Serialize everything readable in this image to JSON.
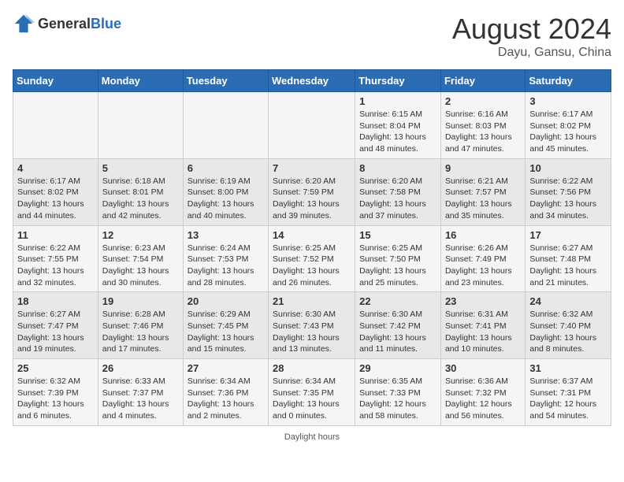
{
  "header": {
    "logo_general": "General",
    "logo_blue": "Blue",
    "month_year": "August 2024",
    "location": "Dayu, Gansu, China"
  },
  "days_of_week": [
    "Sunday",
    "Monday",
    "Tuesday",
    "Wednesday",
    "Thursday",
    "Friday",
    "Saturday"
  ],
  "footer": {
    "daylight_label": "Daylight hours"
  },
  "weeks": [
    {
      "cells": [
        {
          "day": "",
          "content": ""
        },
        {
          "day": "",
          "content": ""
        },
        {
          "day": "",
          "content": ""
        },
        {
          "day": "",
          "content": ""
        },
        {
          "day": "1",
          "content": "Sunrise: 6:15 AM\nSunset: 8:04 PM\nDaylight: 13 hours\nand 48 minutes."
        },
        {
          "day": "2",
          "content": "Sunrise: 6:16 AM\nSunset: 8:03 PM\nDaylight: 13 hours\nand 47 minutes."
        },
        {
          "day": "3",
          "content": "Sunrise: 6:17 AM\nSunset: 8:02 PM\nDaylight: 13 hours\nand 45 minutes."
        }
      ]
    },
    {
      "cells": [
        {
          "day": "4",
          "content": "Sunrise: 6:17 AM\nSunset: 8:02 PM\nDaylight: 13 hours\nand 44 minutes."
        },
        {
          "day": "5",
          "content": "Sunrise: 6:18 AM\nSunset: 8:01 PM\nDaylight: 13 hours\nand 42 minutes."
        },
        {
          "day": "6",
          "content": "Sunrise: 6:19 AM\nSunset: 8:00 PM\nDaylight: 13 hours\nand 40 minutes."
        },
        {
          "day": "7",
          "content": "Sunrise: 6:20 AM\nSunset: 7:59 PM\nDaylight: 13 hours\nand 39 minutes."
        },
        {
          "day": "8",
          "content": "Sunrise: 6:20 AM\nSunset: 7:58 PM\nDaylight: 13 hours\nand 37 minutes."
        },
        {
          "day": "9",
          "content": "Sunrise: 6:21 AM\nSunset: 7:57 PM\nDaylight: 13 hours\nand 35 minutes."
        },
        {
          "day": "10",
          "content": "Sunrise: 6:22 AM\nSunset: 7:56 PM\nDaylight: 13 hours\nand 34 minutes."
        }
      ]
    },
    {
      "cells": [
        {
          "day": "11",
          "content": "Sunrise: 6:22 AM\nSunset: 7:55 PM\nDaylight: 13 hours\nand 32 minutes."
        },
        {
          "day": "12",
          "content": "Sunrise: 6:23 AM\nSunset: 7:54 PM\nDaylight: 13 hours\nand 30 minutes."
        },
        {
          "day": "13",
          "content": "Sunrise: 6:24 AM\nSunset: 7:53 PM\nDaylight: 13 hours\nand 28 minutes."
        },
        {
          "day": "14",
          "content": "Sunrise: 6:25 AM\nSunset: 7:52 PM\nDaylight: 13 hours\nand 26 minutes."
        },
        {
          "day": "15",
          "content": "Sunrise: 6:25 AM\nSunset: 7:50 PM\nDaylight: 13 hours\nand 25 minutes."
        },
        {
          "day": "16",
          "content": "Sunrise: 6:26 AM\nSunset: 7:49 PM\nDaylight: 13 hours\nand 23 minutes."
        },
        {
          "day": "17",
          "content": "Sunrise: 6:27 AM\nSunset: 7:48 PM\nDaylight: 13 hours\nand 21 minutes."
        }
      ]
    },
    {
      "cells": [
        {
          "day": "18",
          "content": "Sunrise: 6:27 AM\nSunset: 7:47 PM\nDaylight: 13 hours\nand 19 minutes."
        },
        {
          "day": "19",
          "content": "Sunrise: 6:28 AM\nSunset: 7:46 PM\nDaylight: 13 hours\nand 17 minutes."
        },
        {
          "day": "20",
          "content": "Sunrise: 6:29 AM\nSunset: 7:45 PM\nDaylight: 13 hours\nand 15 minutes."
        },
        {
          "day": "21",
          "content": "Sunrise: 6:30 AM\nSunset: 7:43 PM\nDaylight: 13 hours\nand 13 minutes."
        },
        {
          "day": "22",
          "content": "Sunrise: 6:30 AM\nSunset: 7:42 PM\nDaylight: 13 hours\nand 11 minutes."
        },
        {
          "day": "23",
          "content": "Sunrise: 6:31 AM\nSunset: 7:41 PM\nDaylight: 13 hours\nand 10 minutes."
        },
        {
          "day": "24",
          "content": "Sunrise: 6:32 AM\nSunset: 7:40 PM\nDaylight: 13 hours\nand 8 minutes."
        }
      ]
    },
    {
      "cells": [
        {
          "day": "25",
          "content": "Sunrise: 6:32 AM\nSunset: 7:39 PM\nDaylight: 13 hours\nand 6 minutes."
        },
        {
          "day": "26",
          "content": "Sunrise: 6:33 AM\nSunset: 7:37 PM\nDaylight: 13 hours\nand 4 minutes."
        },
        {
          "day": "27",
          "content": "Sunrise: 6:34 AM\nSunset: 7:36 PM\nDaylight: 13 hours\nand 2 minutes."
        },
        {
          "day": "28",
          "content": "Sunrise: 6:34 AM\nSunset: 7:35 PM\nDaylight: 13 hours\nand 0 minutes."
        },
        {
          "day": "29",
          "content": "Sunrise: 6:35 AM\nSunset: 7:33 PM\nDaylight: 12 hours\nand 58 minutes."
        },
        {
          "day": "30",
          "content": "Sunrise: 6:36 AM\nSunset: 7:32 PM\nDaylight: 12 hours\nand 56 minutes."
        },
        {
          "day": "31",
          "content": "Sunrise: 6:37 AM\nSunset: 7:31 PM\nDaylight: 12 hours\nand 54 minutes."
        }
      ]
    }
  ]
}
